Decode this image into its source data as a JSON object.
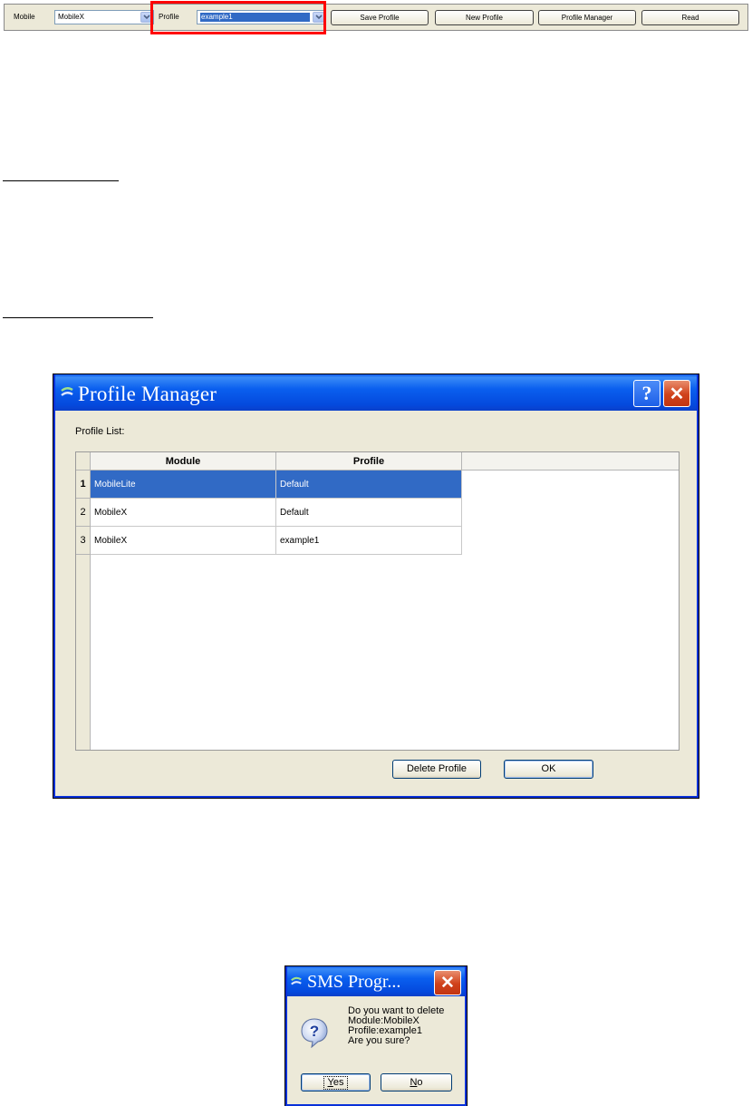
{
  "toolbar": {
    "mobile_label": "Mobile",
    "mobile_value": "MobileX",
    "profile_label": "Profile",
    "profile_value": "example1",
    "buttons": [
      "Save Profile",
      "New Profile",
      "Profile Manager",
      "Read"
    ]
  },
  "profile_manager": {
    "title": "Profile Manager",
    "help_glyph": "?",
    "close_glyph": "✕",
    "list_label": "Profile List:",
    "columns": [
      "Module",
      "Profile"
    ],
    "rows": [
      {
        "num": "1",
        "module": "MobileLite",
        "profile": "Default"
      },
      {
        "num": "2",
        "module": "MobileX",
        "profile": "Default"
      },
      {
        "num": "3",
        "module": "MobileX",
        "profile": "example1"
      }
    ],
    "delete_button": "Delete Profile",
    "ok_button": "OK"
  },
  "sms_dialog": {
    "title": "SMS Progr...",
    "close_glyph": "✕",
    "message_lines": [
      "Do you want to delete",
      "Module:MobileX",
      "Profile:example1",
      "Are you sure?"
    ],
    "yes_mnemonic": "Y",
    "yes_rest": "es",
    "no_mnemonic": "N",
    "no_rest": "o"
  },
  "colors": {
    "xp_title_blue": "#0a5fef",
    "selection_blue": "#316ac5",
    "highlight_red": "#ff0000",
    "dialog_bg": "#ece9d8"
  },
  "icons": [
    "chevron-down-icon",
    "app-icon",
    "help-icon",
    "close-icon",
    "question-icon"
  ]
}
